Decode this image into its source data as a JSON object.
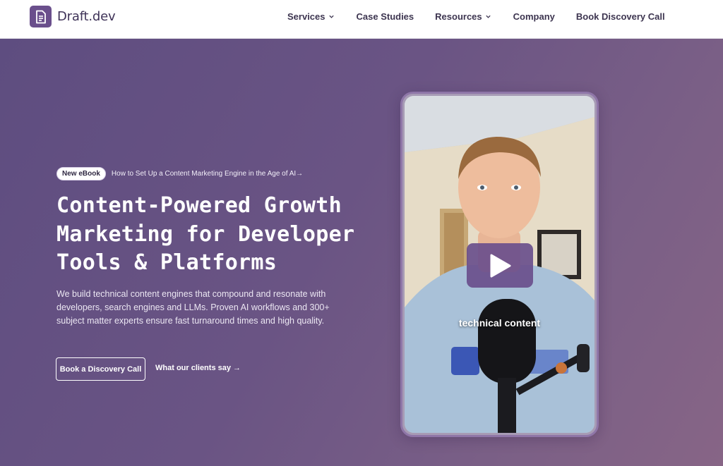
{
  "header": {
    "brand": "Draft.dev",
    "nav": [
      {
        "label": "Services",
        "has_dropdown": true
      },
      {
        "label": "Case Studies",
        "has_dropdown": false
      },
      {
        "label": "Resources",
        "has_dropdown": true
      },
      {
        "label": "Company",
        "has_dropdown": false
      },
      {
        "label": "Book Discovery Call",
        "has_dropdown": false
      }
    ]
  },
  "hero": {
    "promo_badge": "New eBook",
    "promo_text": "How to Set Up a Content Marketing Engine in the Age of AI→",
    "headline_lines": [
      "Content-Powered Growth",
      "Marketing for Developer",
      "Tools & Platforms"
    ],
    "description": "We build technical content engines that compound and resonate with developers, search engines and LLMs. Proven AI workflows and 300+ subject matter experts ensure fast turnaround times and high quality.",
    "cta_primary": "Book a Discovery Call",
    "cta_secondary": "What our clients say →"
  },
  "video": {
    "caption": "technical content",
    "icon": "play-icon"
  },
  "colors": {
    "brand": "#6a4f8c",
    "nav_text": "#3d3550",
    "hero_start": "#5e4d80",
    "hero_end": "#876586"
  }
}
